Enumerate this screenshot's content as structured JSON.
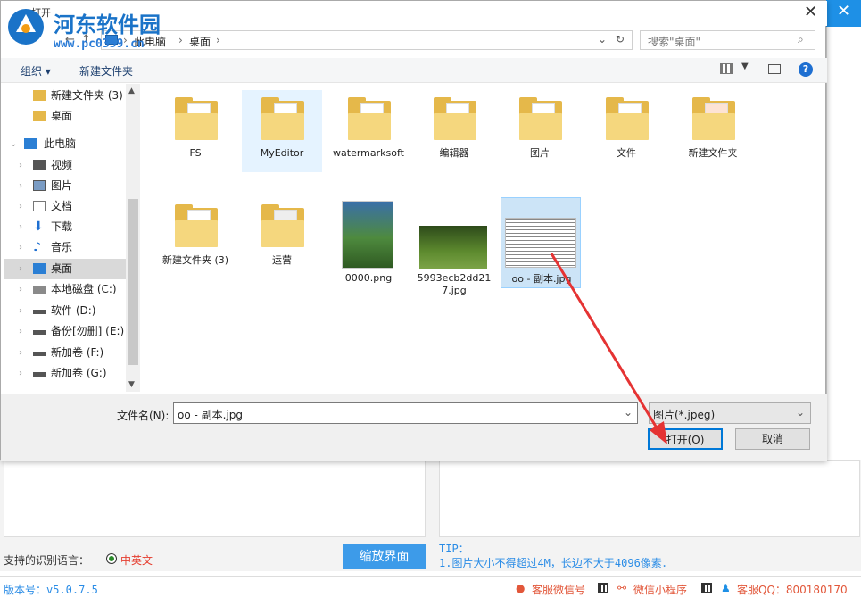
{
  "dialog": {
    "title": "打开",
    "breadcrumb": [
      "此电脑",
      "桌面"
    ],
    "search_placeholder": "搜索\"桌面\"",
    "toolbar": {
      "organize": "组织 ▾",
      "new_folder": "新建文件夹"
    },
    "nav_items": [
      {
        "label": "新建文件夹 (3)",
        "icon": "folder-icon"
      },
      {
        "label": "桌面",
        "icon": "folder-icon"
      },
      {
        "label": "此电脑",
        "icon": "computer-icon"
      },
      {
        "label": "视频",
        "icon": "video-icon"
      },
      {
        "label": "图片",
        "icon": "picture-icon"
      },
      {
        "label": "文档",
        "icon": "document-icon"
      },
      {
        "label": "下载",
        "icon": "download-icon"
      },
      {
        "label": "音乐",
        "icon": "music-icon"
      },
      {
        "label": "桌面",
        "icon": "desktop-icon"
      },
      {
        "label": "本地磁盘 (C:)",
        "icon": "drive-icon"
      },
      {
        "label": "软件 (D:)",
        "icon": "drive-icon"
      },
      {
        "label": "备份[勿删] (E:)",
        "icon": "drive-icon"
      },
      {
        "label": "新加卷 (F:)",
        "icon": "drive-icon"
      },
      {
        "label": "新加卷 (G:)",
        "icon": "drive-icon"
      }
    ],
    "files": [
      {
        "label": "FS",
        "kind": "folder"
      },
      {
        "label": "MyEditor",
        "kind": "folder"
      },
      {
        "label": "watermarksoft",
        "kind": "folder"
      },
      {
        "label": "编辑器",
        "kind": "folder"
      },
      {
        "label": "图片",
        "kind": "folder"
      },
      {
        "label": "文件",
        "kind": "folder"
      },
      {
        "label": "新建文件夹",
        "kind": "folder"
      },
      {
        "label": "新建文件夹 (3)",
        "kind": "folder"
      },
      {
        "label": "运营",
        "kind": "folder"
      },
      {
        "label": "0000.png",
        "kind": "image"
      },
      {
        "label": "5993ecb2dd217.jpg",
        "kind": "image"
      },
      {
        "label": "oo - 副本.jpg",
        "kind": "image"
      }
    ],
    "filename_label": "文件名(N):",
    "filename_value": "oo - 副本.jpg",
    "filetype_value": "图片(*.jpeg)",
    "open_button": "打开(O)",
    "cancel_button": "取消"
  },
  "watermark": {
    "site": "河东软件园",
    "url": "www.pc0359.cn"
  },
  "app": {
    "lang_label": "支持的识别语言：",
    "lang_value": "中英文",
    "zoom_button": "缩放界面",
    "tip_title": "TIP：",
    "tip_line": "1.图片大小不得超过4M，长边不大于4096像素．",
    "version": "版本号：v5.0.7.5",
    "wechat": "客服微信号",
    "miniprogram": "微信小程序",
    "qq": "客服QQ：800180170"
  },
  "colors": {
    "accent": "#1e90e6",
    "annotation": "#e53333"
  }
}
